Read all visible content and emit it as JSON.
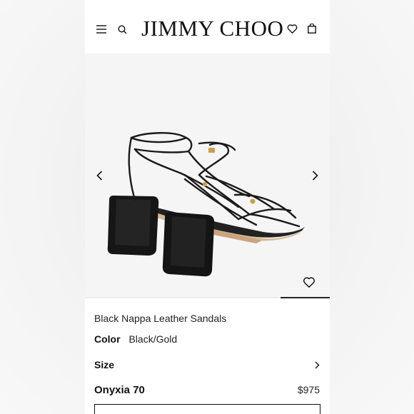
{
  "header": {
    "logo": "JIMMY CHOO",
    "icons": [
      "menu-icon",
      "search-icon",
      "heart-icon",
      "bag-icon"
    ]
  },
  "gallery": {
    "image": "black strappy block-heel sandal",
    "progress": 0.2
  },
  "product": {
    "name": "Black Nappa Leather Sandals",
    "color_label": "Color",
    "color_value": "Black/Gold",
    "size_label": "Size",
    "style_name": "Onyxia 70",
    "price": "$975"
  },
  "colors": {
    "text": "#111111",
    "background": "#ffffff",
    "gallery_bg": "#f5f5f5"
  }
}
